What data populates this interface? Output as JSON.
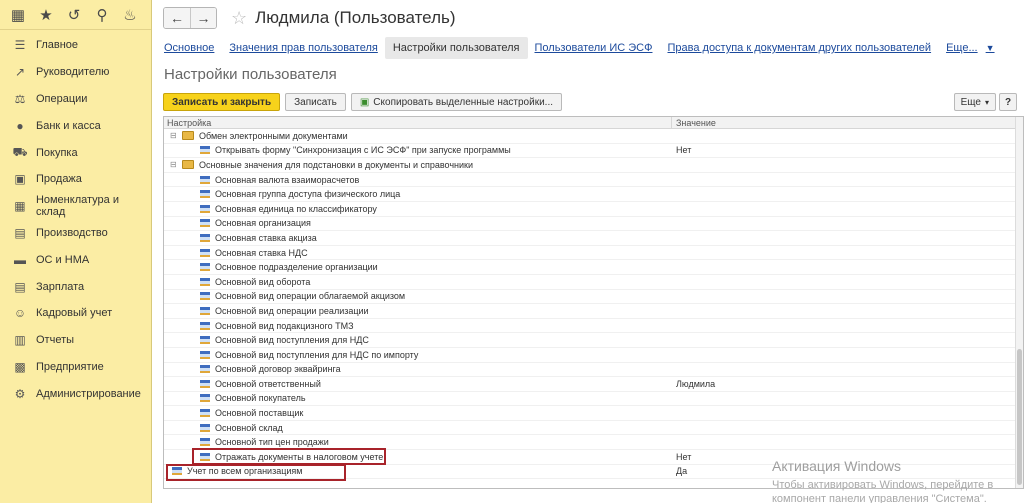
{
  "sidebar": {
    "top_icons": [
      "apps-grid-icon",
      "star-icon",
      "history-icon",
      "search-icon",
      "bell-icon"
    ],
    "items": [
      {
        "label": "Главное",
        "icon": "menu-icon"
      },
      {
        "label": "Руководителю",
        "icon": "chart-line-icon"
      },
      {
        "label": "Операции",
        "icon": "operations-icon"
      },
      {
        "label": "Банк и касса",
        "icon": "coin-icon"
      },
      {
        "label": "Покупка",
        "icon": "cart-icon"
      },
      {
        "label": "Продажа",
        "icon": "bag-icon"
      },
      {
        "label": "Номенклатура и склад",
        "icon": "warehouse-icon"
      },
      {
        "label": "Производство",
        "icon": "factory-icon"
      },
      {
        "label": "ОС и НМА",
        "icon": "truck-icon"
      },
      {
        "label": "Зарплата",
        "icon": "salary-icon"
      },
      {
        "label": "Кадровый учет",
        "icon": "people-icon"
      },
      {
        "label": "Отчеты",
        "icon": "report-icon"
      },
      {
        "label": "Предприятие",
        "icon": "building-icon"
      },
      {
        "label": "Администрирование",
        "icon": "gear-icon"
      }
    ]
  },
  "header": {
    "title": "Людмила (Пользователь)"
  },
  "tabs": [
    {
      "label": "Основное",
      "active": false
    },
    {
      "label": "Значения прав пользователя",
      "active": false
    },
    {
      "label": "Настройки пользователя",
      "active": true
    },
    {
      "label": "Пользователи ИС ЭСФ",
      "active": false
    },
    {
      "label": "Права доступа к документам других пользователей",
      "active": false
    },
    {
      "label": "Еще...",
      "active": false
    }
  ],
  "section_title": "Настройки пользователя",
  "toolbar": {
    "save_close": "Записать и закрыть",
    "save": "Записать",
    "copy": "Скопировать выделенные настройки...",
    "more": "Еще",
    "help": "?"
  },
  "grid": {
    "col_setting": "Настройка",
    "col_value": "Значение",
    "rows": [
      {
        "level": 0,
        "type": "group",
        "label": "Обмен электронными документами",
        "value": ""
      },
      {
        "level": 1,
        "type": "item",
        "label": "Открывать форму \"Синхронизация с ИС ЭСФ\" при запуске программы",
        "value": "Нет"
      },
      {
        "level": 0,
        "type": "group",
        "label": "Основные значения для подстановки в документы и справочники",
        "value": ""
      },
      {
        "level": 1,
        "type": "item",
        "label": "Основная валюта взаиморасчетов",
        "value": ""
      },
      {
        "level": 1,
        "type": "item",
        "label": "Основная группа доступа физического лица",
        "value": ""
      },
      {
        "level": 1,
        "type": "item",
        "label": "Основная единица по классификатору",
        "value": ""
      },
      {
        "level": 1,
        "type": "item",
        "label": "Основная организация",
        "value": ""
      },
      {
        "level": 1,
        "type": "item",
        "label": "Основная ставка акциза",
        "value": ""
      },
      {
        "level": 1,
        "type": "item",
        "label": "Основная ставка НДС",
        "value": ""
      },
      {
        "level": 1,
        "type": "item",
        "label": "Основное подразделение организации",
        "value": ""
      },
      {
        "level": 1,
        "type": "item",
        "label": "Основной вид оборота",
        "value": ""
      },
      {
        "level": 1,
        "type": "item",
        "label": "Основной вид операции облагаемой акцизом",
        "value": ""
      },
      {
        "level": 1,
        "type": "item",
        "label": "Основной вид операции реализации",
        "value": ""
      },
      {
        "level": 1,
        "type": "item",
        "label": "Основной вид подакцизного ТМЗ",
        "value": ""
      },
      {
        "level": 1,
        "type": "item",
        "label": "Основной вид поступления для НДС",
        "value": ""
      },
      {
        "level": 1,
        "type": "item",
        "label": "Основной вид поступления для НДС по импорту",
        "value": ""
      },
      {
        "level": 1,
        "type": "item",
        "label": "Основной договор эквайринга",
        "value": ""
      },
      {
        "level": 1,
        "type": "item",
        "label": "Основной ответственный",
        "value": "Людмила"
      },
      {
        "level": 1,
        "type": "item",
        "label": "Основной покупатель",
        "value": ""
      },
      {
        "level": 1,
        "type": "item",
        "label": "Основной поставщик",
        "value": ""
      },
      {
        "level": 1,
        "type": "item",
        "label": "Основной склад",
        "value": ""
      },
      {
        "level": 1,
        "type": "item",
        "label": "Основной тип цен продажи",
        "value": ""
      },
      {
        "level": 1,
        "type": "item",
        "label": "Отражать документы в налоговом учете",
        "value": "Нет"
      },
      {
        "level": 0,
        "type": "item",
        "label": "Учет по всем организациям",
        "value": "Да"
      }
    ]
  },
  "watermark": {
    "title": "Активация Windows",
    "text": "Чтобы активировать Windows, перейдите в компонент панели управления \"Система\"."
  }
}
